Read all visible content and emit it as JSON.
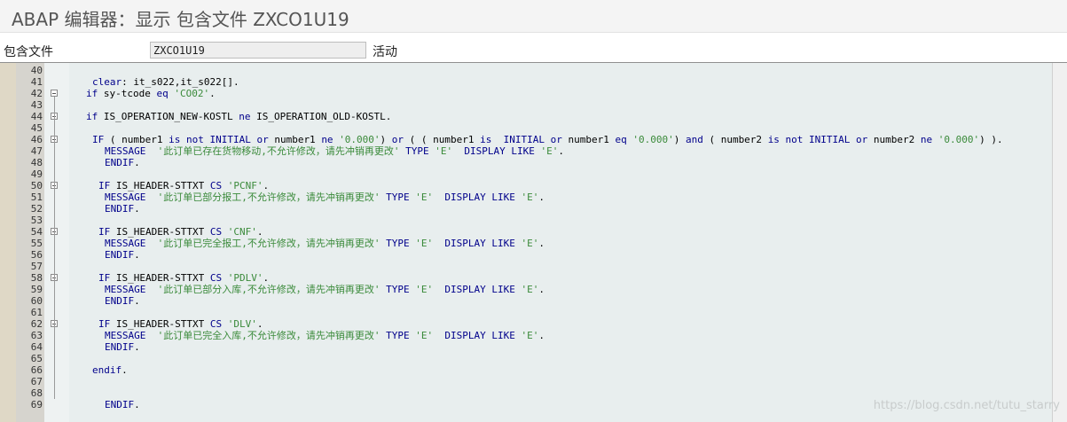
{
  "window": {
    "title": "ABAP 编辑器：显示 包含文件 ZXCO1U19"
  },
  "meta": {
    "include_label": "包含文件",
    "include_value": "ZXCO1U19",
    "status": "活动"
  },
  "editor": {
    "lines": [
      {
        "n": "40",
        "fold": false,
        "indent": 0,
        "tokens": []
      },
      {
        "n": "41",
        "fold": false,
        "indent": 2,
        "tokens": [
          {
            "t": "clear",
            "c": "kw"
          },
          {
            "t": ": it_s022,it_s022[].",
            "c": ""
          }
        ]
      },
      {
        "n": "42",
        "fold": true,
        "indent": 1,
        "tokens": [
          {
            "t": "if",
            "c": "kw"
          },
          {
            "t": " sy-tcode ",
            "c": ""
          },
          {
            "t": "eq",
            "c": "kw"
          },
          {
            "t": " ",
            "c": ""
          },
          {
            "t": "'CO02'",
            "c": "str"
          },
          {
            "t": ".",
            "c": ""
          }
        ]
      },
      {
        "n": "43",
        "fold": false,
        "indent": 0,
        "tokens": []
      },
      {
        "n": "44",
        "fold": true,
        "indent": 1,
        "tokens": [
          {
            "t": "if",
            "c": "kw"
          },
          {
            "t": " IS_OPERATION_NEW-KOSTL ",
            "c": ""
          },
          {
            "t": "ne",
            "c": "kw"
          },
          {
            "t": " IS_OPERATION_OLD-KOSTL.",
            "c": ""
          }
        ]
      },
      {
        "n": "45",
        "fold": false,
        "indent": 0,
        "tokens": []
      },
      {
        "n": "46",
        "fold": true,
        "indent": 2,
        "tokens": [
          {
            "t": "IF",
            "c": "kw"
          },
          {
            "t": " ( number1 ",
            "c": ""
          },
          {
            "t": "is not INITIAL or",
            "c": "kw"
          },
          {
            "t": " number1 ",
            "c": ""
          },
          {
            "t": "ne",
            "c": "kw"
          },
          {
            "t": " ",
            "c": ""
          },
          {
            "t": "'0.000'",
            "c": "str"
          },
          {
            "t": ") ",
            "c": ""
          },
          {
            "t": "or",
            "c": "kw"
          },
          {
            "t": " ( ( number1 ",
            "c": ""
          },
          {
            "t": "is  INITIAL or",
            "c": "kw"
          },
          {
            "t": " number1 ",
            "c": ""
          },
          {
            "t": "eq",
            "c": "kw"
          },
          {
            "t": " ",
            "c": ""
          },
          {
            "t": "'0.000'",
            "c": "str"
          },
          {
            "t": ") ",
            "c": ""
          },
          {
            "t": "and",
            "c": "kw"
          },
          {
            "t": " ( number2 ",
            "c": ""
          },
          {
            "t": "is not INITIAL or",
            "c": "kw"
          },
          {
            "t": " number2 ",
            "c": ""
          },
          {
            "t": "ne",
            "c": "kw"
          },
          {
            "t": " ",
            "c": ""
          },
          {
            "t": "'0.000'",
            "c": "str"
          },
          {
            "t": ") ).",
            "c": ""
          }
        ]
      },
      {
        "n": "47",
        "fold": false,
        "indent": 4,
        "tokens": [
          {
            "t": "MESSAGE",
            "c": "kw"
          },
          {
            "t": "  ",
            "c": ""
          },
          {
            "t": "'此订单已存在货物移动,不允许修改，请先冲销再更改'",
            "c": "str"
          },
          {
            "t": " ",
            "c": ""
          },
          {
            "t": "TYPE",
            "c": "kw"
          },
          {
            "t": " ",
            "c": ""
          },
          {
            "t": "'E'",
            "c": "str"
          },
          {
            "t": "  ",
            "c": ""
          },
          {
            "t": "DISPLAY LIKE",
            "c": "kw"
          },
          {
            "t": " ",
            "c": ""
          },
          {
            "t": "'E'",
            "c": "str"
          },
          {
            "t": ".",
            "c": ""
          }
        ]
      },
      {
        "n": "48",
        "fold": false,
        "indent": 4,
        "tokens": [
          {
            "t": "ENDIF",
            "c": "kw"
          },
          {
            "t": ".",
            "c": ""
          }
        ]
      },
      {
        "n": "49",
        "fold": false,
        "indent": 0,
        "tokens": []
      },
      {
        "n": "50",
        "fold": true,
        "indent": 3,
        "tokens": [
          {
            "t": "IF",
            "c": "kw"
          },
          {
            "t": " IS_HEADER-STTXT ",
            "c": ""
          },
          {
            "t": "CS",
            "c": "kw"
          },
          {
            "t": " ",
            "c": ""
          },
          {
            "t": "'PCNF'",
            "c": "str"
          },
          {
            "t": ".",
            "c": ""
          }
        ]
      },
      {
        "n": "51",
        "fold": false,
        "indent": 4,
        "tokens": [
          {
            "t": "MESSAGE",
            "c": "kw"
          },
          {
            "t": "  ",
            "c": ""
          },
          {
            "t": "'此订单已部分报工,不允许修改，请先冲销再更改'",
            "c": "str"
          },
          {
            "t": " ",
            "c": ""
          },
          {
            "t": "TYPE",
            "c": "kw"
          },
          {
            "t": " ",
            "c": ""
          },
          {
            "t": "'E'",
            "c": "str"
          },
          {
            "t": "  ",
            "c": ""
          },
          {
            "t": "DISPLAY LIKE",
            "c": "kw"
          },
          {
            "t": " ",
            "c": ""
          },
          {
            "t": "'E'",
            "c": "str"
          },
          {
            "t": ".",
            "c": ""
          }
        ]
      },
      {
        "n": "52",
        "fold": false,
        "indent": 4,
        "tokens": [
          {
            "t": "ENDIF",
            "c": "kw"
          },
          {
            "t": ".",
            "c": ""
          }
        ]
      },
      {
        "n": "53",
        "fold": false,
        "indent": 0,
        "tokens": []
      },
      {
        "n": "54",
        "fold": true,
        "indent": 3,
        "tokens": [
          {
            "t": "IF",
            "c": "kw"
          },
          {
            "t": " IS_HEADER-STTXT ",
            "c": ""
          },
          {
            "t": "CS",
            "c": "kw"
          },
          {
            "t": " ",
            "c": ""
          },
          {
            "t": "'CNF'",
            "c": "str"
          },
          {
            "t": ".",
            "c": ""
          }
        ]
      },
      {
        "n": "55",
        "fold": false,
        "indent": 4,
        "tokens": [
          {
            "t": "MESSAGE",
            "c": "kw"
          },
          {
            "t": "  ",
            "c": ""
          },
          {
            "t": "'此订单已完全报工,不允许修改，请先冲销再更改'",
            "c": "str"
          },
          {
            "t": " ",
            "c": ""
          },
          {
            "t": "TYPE",
            "c": "kw"
          },
          {
            "t": " ",
            "c": ""
          },
          {
            "t": "'E'",
            "c": "str"
          },
          {
            "t": "  ",
            "c": ""
          },
          {
            "t": "DISPLAY LIKE",
            "c": "kw"
          },
          {
            "t": " ",
            "c": ""
          },
          {
            "t": "'E'",
            "c": "str"
          },
          {
            "t": ".",
            "c": ""
          }
        ]
      },
      {
        "n": "56",
        "fold": false,
        "indent": 4,
        "tokens": [
          {
            "t": "ENDIF",
            "c": "kw"
          },
          {
            "t": ".",
            "c": ""
          }
        ]
      },
      {
        "n": "57",
        "fold": false,
        "indent": 0,
        "tokens": []
      },
      {
        "n": "58",
        "fold": true,
        "indent": 3,
        "tokens": [
          {
            "t": "IF",
            "c": "kw"
          },
          {
            "t": " IS_HEADER-STTXT ",
            "c": ""
          },
          {
            "t": "CS",
            "c": "kw"
          },
          {
            "t": " ",
            "c": ""
          },
          {
            "t": "'PDLV'",
            "c": "str"
          },
          {
            "t": ".",
            "c": ""
          }
        ]
      },
      {
        "n": "59",
        "fold": false,
        "indent": 4,
        "tokens": [
          {
            "t": "MESSAGE",
            "c": "kw"
          },
          {
            "t": "  ",
            "c": ""
          },
          {
            "t": "'此订单已部分入库,不允许修改，请先冲销再更改'",
            "c": "str"
          },
          {
            "t": " ",
            "c": ""
          },
          {
            "t": "TYPE",
            "c": "kw"
          },
          {
            "t": " ",
            "c": ""
          },
          {
            "t": "'E'",
            "c": "str"
          },
          {
            "t": "  ",
            "c": ""
          },
          {
            "t": "DISPLAY LIKE",
            "c": "kw"
          },
          {
            "t": " ",
            "c": ""
          },
          {
            "t": "'E'",
            "c": "str"
          },
          {
            "t": ".",
            "c": ""
          }
        ]
      },
      {
        "n": "60",
        "fold": false,
        "indent": 4,
        "tokens": [
          {
            "t": "ENDIF",
            "c": "kw"
          },
          {
            "t": ".",
            "c": ""
          }
        ]
      },
      {
        "n": "61",
        "fold": false,
        "indent": 0,
        "tokens": []
      },
      {
        "n": "62",
        "fold": true,
        "indent": 3,
        "tokens": [
          {
            "t": "IF",
            "c": "kw"
          },
          {
            "t": " IS_HEADER-STTXT ",
            "c": ""
          },
          {
            "t": "CS",
            "c": "kw"
          },
          {
            "t": " ",
            "c": ""
          },
          {
            "t": "'DLV'",
            "c": "str"
          },
          {
            "t": ".",
            "c": ""
          }
        ]
      },
      {
        "n": "63",
        "fold": false,
        "indent": 4,
        "tokens": [
          {
            "t": "MESSAGE",
            "c": "kw"
          },
          {
            "t": "  ",
            "c": ""
          },
          {
            "t": "'此订单已完全入库,不允许修改，请先冲销再更改'",
            "c": "str"
          },
          {
            "t": " ",
            "c": ""
          },
          {
            "t": "TYPE",
            "c": "kw"
          },
          {
            "t": " ",
            "c": ""
          },
          {
            "t": "'E'",
            "c": "str"
          },
          {
            "t": "  ",
            "c": ""
          },
          {
            "t": "DISPLAY LIKE",
            "c": "kw"
          },
          {
            "t": " ",
            "c": ""
          },
          {
            "t": "'E'",
            "c": "str"
          },
          {
            "t": ".",
            "c": ""
          }
        ]
      },
      {
        "n": "64",
        "fold": false,
        "indent": 4,
        "tokens": [
          {
            "t": "ENDIF",
            "c": "kw"
          },
          {
            "t": ".",
            "c": ""
          }
        ]
      },
      {
        "n": "65",
        "fold": false,
        "indent": 0,
        "tokens": []
      },
      {
        "n": "66",
        "fold": false,
        "indent": 2,
        "tokens": [
          {
            "t": "endif",
            "c": "kw"
          },
          {
            "t": ".",
            "c": ""
          }
        ]
      },
      {
        "n": "67",
        "fold": false,
        "indent": 0,
        "tokens": []
      },
      {
        "n": "68",
        "fold": false,
        "indent": 0,
        "tokens": []
      },
      {
        "n": "69",
        "fold": false,
        "indent": 4,
        "tokens": [
          {
            "t": "ENDIF",
            "c": "kw"
          },
          {
            "t": ".",
            "c": ""
          }
        ]
      }
    ]
  },
  "watermark": "https://blog.csdn.net/tutu_starry",
  "colors": {
    "keyword": "#00008b",
    "string": "#3a8a3a",
    "editor_bg": "#e8eeee",
    "gutter_bg": "#d6d4ce"
  }
}
